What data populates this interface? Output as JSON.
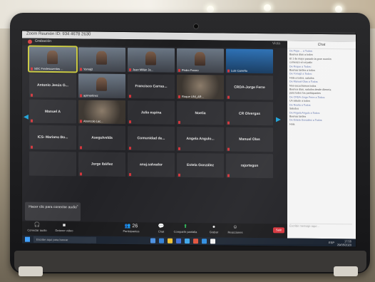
{
  "window": {
    "title": "Zoom Reunión ID: 934 4678 2630",
    "meeting_label": "Grabación",
    "view_label": "Vista"
  },
  "participants": [
    {
      "name": "SDC Fredescuentos ...",
      "video": "person",
      "active": true
    },
    {
      "name": "Yomaj2",
      "video": "person"
    },
    {
      "name": "Juan Millán Ja...",
      "video": "person"
    },
    {
      "name": "Pedro Forero",
      "video": "person"
    },
    {
      "name": "Luis Carreño",
      "video": "blue"
    },
    {
      "name": "Antonio Jesús G...",
      "video": "none"
    },
    {
      "name": "apimartinez",
      "video": "person"
    },
    {
      "name": "Francisco Carras...",
      "video": "none"
    },
    {
      "name": "Roque UNI_AR...",
      "video": "photo"
    },
    {
      "name": "CRDA-Jorge Ferre",
      "video": "none"
    },
    {
      "name": "Manuel A",
      "video": "none"
    },
    {
      "name": "Aboncolo Lac...",
      "video": "photo"
    },
    {
      "name": "Julia espina",
      "video": "none"
    },
    {
      "name": "Noelia",
      "video": "none"
    },
    {
      "name": "CR Olvergas",
      "video": "none"
    },
    {
      "name": "ICS- Mariano Bo...",
      "video": "none"
    },
    {
      "name": "Asegulvelda",
      "video": "none"
    },
    {
      "name": "Comunidad de...",
      "video": "none"
    },
    {
      "name": "Angela Angulo...",
      "video": "none"
    },
    {
      "name": "Manuel Olas",
      "video": "none"
    },
    {
      "name": "",
      "video": "empty"
    },
    {
      "name": "Jorge Ibáñez",
      "video": "none"
    },
    {
      "name": "anaj.salvador",
      "video": "none"
    },
    {
      "name": "Estela González",
      "video": "none"
    },
    {
      "name": "rajortegon",
      "video": "none"
    }
  ],
  "tooltip": {
    "text": "Hacer clic para conectar audio",
    "close": "×"
  },
  "toolbar": [
    {
      "id": "audio",
      "icon": "🎧",
      "label": "Conectar audio"
    },
    {
      "id": "video",
      "icon": "■",
      "label": "Detener video"
    },
    {
      "id": "participants",
      "icon": "👥 26",
      "label": "Participantes"
    },
    {
      "id": "chat",
      "icon": "💬",
      "label": "Chat"
    },
    {
      "id": "share",
      "icon": "⬆",
      "label": "Compartir pantalla"
    },
    {
      "id": "record",
      "icon": "●",
      "label": "Grabar"
    },
    {
      "id": "reactions",
      "icon": "☺",
      "label": "Reacciones"
    }
  ],
  "leave_label": "Salir",
  "chat": {
    "header": "Chat",
    "messages": [
      "De Pepe ... a Todos:",
      "Buenos días a todos",
      "El 1 de mayo pasado la gran reunión",
      "comenzó en el patio",
      "De Roque a Todos:",
      "Buenas tardes a todos",
      "De Yomaj2 a Todos:",
      "Hola a todos, saludos",
      "De Manuel Olas a Todos:",
      "Nos escuchamos todos",
      "Buenos días, saludos desde Almería",
      "para todos los participantes",
      "De CRDA-Jorge Ferre a Todos:",
      "Un saludo a todos",
      "De Noelia a Todos:",
      "Saludos",
      "De Angela Angulo a Todos:",
      "Buenas tardes",
      "De Estela González a Todos:",
      "Hola"
    ],
    "input_placeholder": "Escribir mensaje aquí..."
  },
  "taskbar": {
    "search_placeholder": "Escribe aquí para buscar",
    "lang": "ESP",
    "time": "17:55",
    "date": "29/05/2020"
  }
}
